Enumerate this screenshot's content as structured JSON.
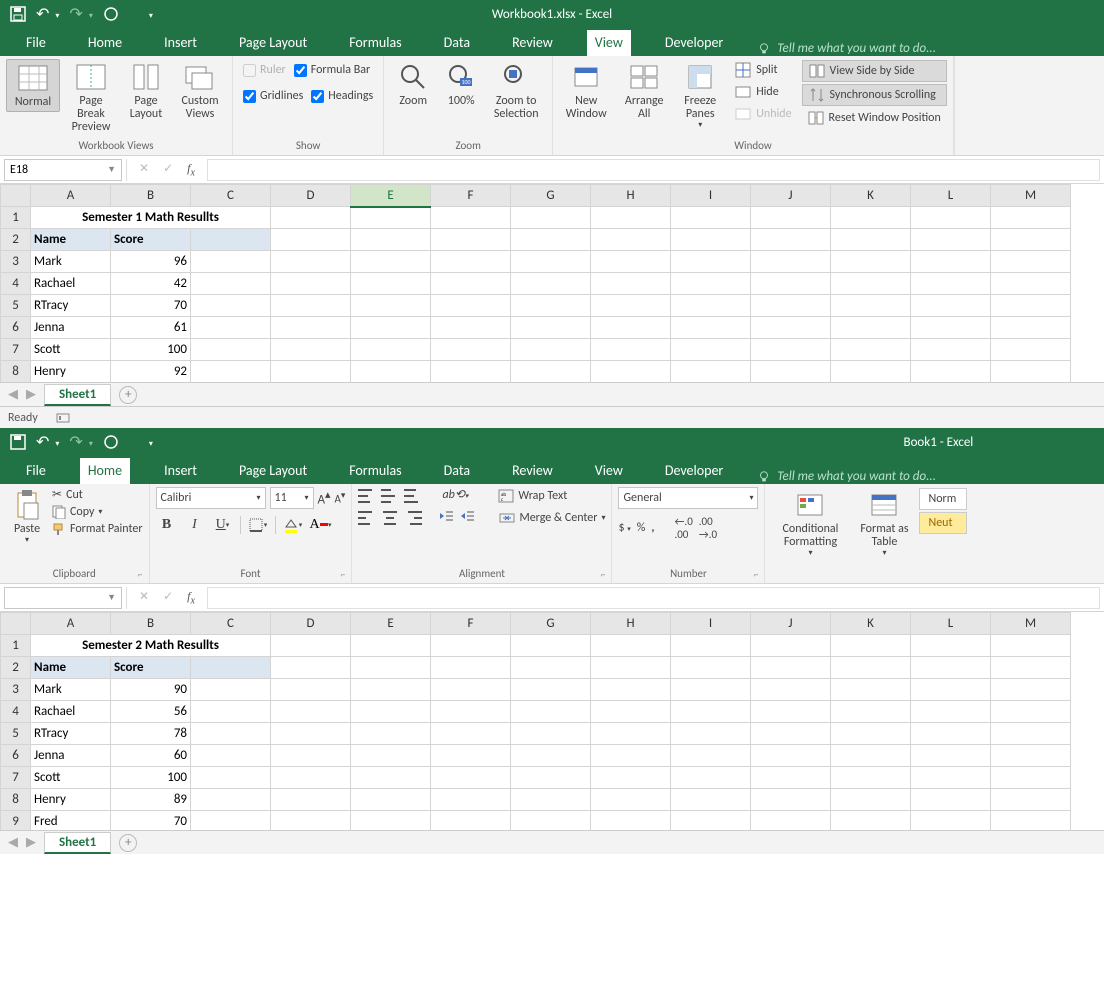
{
  "window1": {
    "title": "Workbook1.xlsx - Excel",
    "tabs": [
      "File",
      "Home",
      "Insert",
      "Page Layout",
      "Formulas",
      "Data",
      "Review",
      "View",
      "Developer"
    ],
    "active_tab": "View",
    "tell_me": "Tell me what you want to do...",
    "ribbon": {
      "views_group": "Workbook Views",
      "views": {
        "normal": "Normal",
        "pagebreak": "Page Break Preview",
        "pagelayout": "Page Layout",
        "custom": "Custom Views"
      },
      "show_group": "Show",
      "show": {
        "ruler": "Ruler",
        "formula": "Formula Bar",
        "gridlines": "Gridlines",
        "headings": "Headings"
      },
      "zoom_group": "Zoom",
      "zoom": {
        "zoom": "Zoom",
        "hundred": "100%",
        "tosel": "Zoom to Selection"
      },
      "window_group": "Window",
      "wnd": {
        "newwin": "New Window",
        "arrange": "Arrange All",
        "freeze": "Freeze Panes",
        "split": "Split",
        "hide": "Hide",
        "unhide": "Unhide",
        "side": "View Side by Side",
        "sync": "Synchronous Scrolling",
        "reset": "Reset Window Position"
      }
    },
    "namebox": "E18",
    "sheet_tab": "Sheet1",
    "status": "Ready",
    "columns": [
      "A",
      "B",
      "C",
      "D",
      "E",
      "F",
      "G",
      "H",
      "I",
      "J",
      "K",
      "L",
      "M"
    ],
    "sel_col": "E",
    "data": {
      "title": "Semester 1 Math Resullts",
      "h1": "Name",
      "h2": "Score",
      "rows": [
        {
          "n": "Mark",
          "s": 96
        },
        {
          "n": "Rachael",
          "s": 42
        },
        {
          "n": "RTracy",
          "s": 70
        },
        {
          "n": "Jenna",
          "s": 61
        },
        {
          "n": "Scott",
          "s": 100
        },
        {
          "n": "Henry",
          "s": 92
        }
      ]
    }
  },
  "window2": {
    "title": "Book1 - Excel",
    "tabs": [
      "File",
      "Home",
      "Insert",
      "Page Layout",
      "Formulas",
      "Data",
      "Review",
      "View",
      "Developer"
    ],
    "active_tab": "Home",
    "tell_me": "Tell me what you want to do...",
    "ribbon": {
      "clipboard_group": "Clipboard",
      "clip": {
        "paste": "Paste",
        "cut": "Cut",
        "copy": "Copy",
        "painter": "Format Painter"
      },
      "font_group": "Font",
      "font": {
        "name": "Calibri",
        "size": "11"
      },
      "align_group": "Alignment",
      "align": {
        "wrap": "Wrap Text",
        "merge": "Merge & Center"
      },
      "number_group": "Number",
      "number": {
        "format": "General"
      },
      "styles": {
        "cond": "Conditional Formatting",
        "table": "Format as Table",
        "normal": "Norm",
        "neutral": "Neut"
      }
    },
    "namebox": "",
    "sheet_tab": "Sheet1",
    "columns": [
      "A",
      "B",
      "C",
      "D",
      "E",
      "F",
      "G",
      "H",
      "I",
      "J",
      "K",
      "L",
      "M"
    ],
    "data": {
      "title": "Semester 2 Math Resullts",
      "h1": "Name",
      "h2": "Score",
      "rows": [
        {
          "n": "Mark",
          "s": 90
        },
        {
          "n": "Rachael",
          "s": 56
        },
        {
          "n": "RTracy",
          "s": 78
        },
        {
          "n": "Jenna",
          "s": 60
        },
        {
          "n": "Scott",
          "s": 100
        },
        {
          "n": "Henry",
          "s": 89
        },
        {
          "n": "Fred",
          "s": 70
        }
      ]
    }
  }
}
